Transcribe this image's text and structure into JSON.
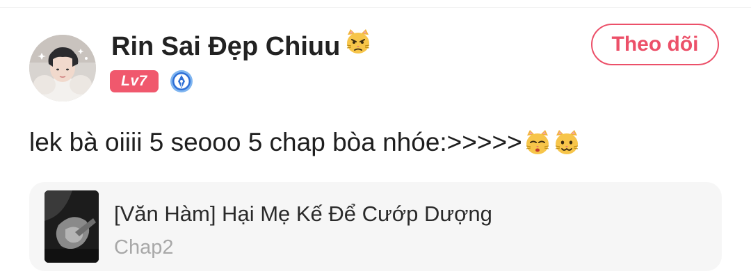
{
  "user": {
    "name": "Rin Sai Đẹp Chiuu",
    "level": "Lv7",
    "name_emoji": "pouting-cat-emoji",
    "medal_icon": "blue-pen-medal-icon"
  },
  "follow_button": {
    "label": "Theo dõi"
  },
  "comment": {
    "text": "lek bà oiiii 5 seooo 5 chap bòa nhóe:>>>>>",
    "trailing_emojis": [
      "kissing-cat-emoji",
      "smiling-cat-emoji"
    ]
  },
  "story": {
    "title": "[Văn Hàm] Hại Mẹ Kế Để Cướp Dượng",
    "chapter": "Chap2"
  },
  "colors": {
    "accent": "#ec5069",
    "level_badge": "#f0586d",
    "card_background": "#f6f6f6",
    "muted_text": "#a8a8a8"
  }
}
